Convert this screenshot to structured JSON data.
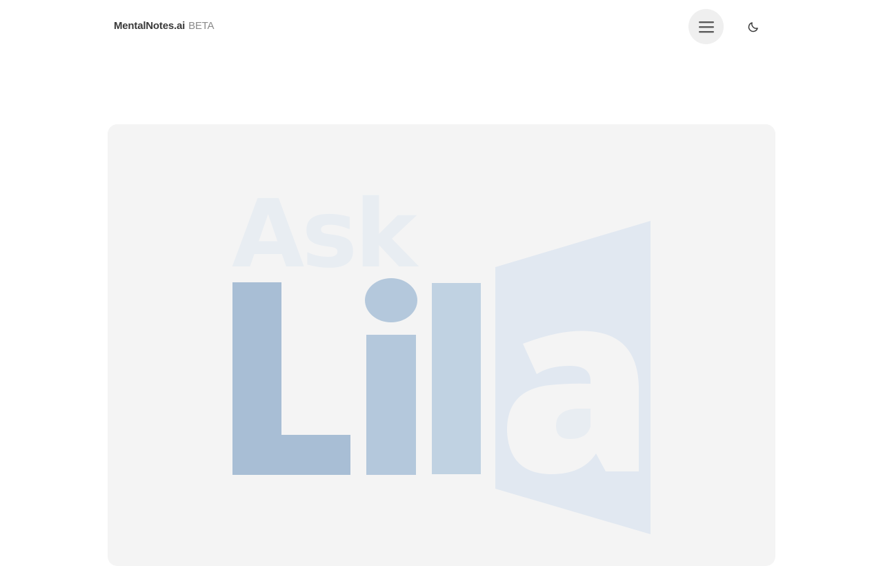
{
  "header": {
    "brand_name": "MentalNotes.ai",
    "brand_badge": "BETA",
    "menu_icon": "hamburger-menu-icon",
    "theme_icon": "moon-icon"
  },
  "hero": {
    "logo_text_top": "Ask",
    "logo_text_bottom": "Lila",
    "colors": {
      "card_background": "#f4f4f4",
      "ask_text": "#e8edf2",
      "letter_L": "#a8bed5",
      "letter_i": "#b4c8dc",
      "letter_l": "#c0d2e2",
      "door_panel": "#e1e8f1",
      "letter_a": "#f4f4f4"
    }
  }
}
